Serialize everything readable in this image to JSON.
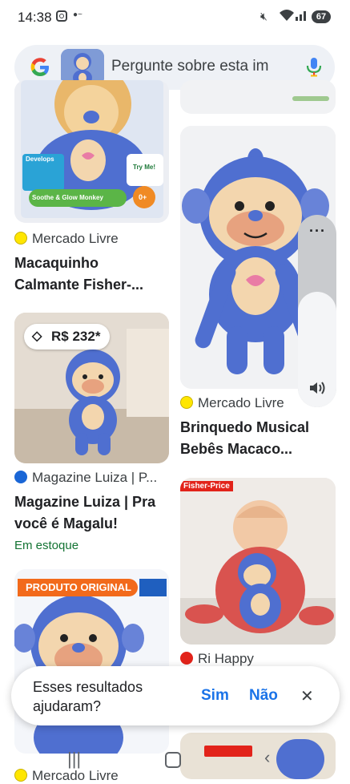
{
  "status_bar": {
    "time": "14:38",
    "battery": "67",
    "icons": [
      "instagram-icon",
      "mute-icon",
      "wifi-icon",
      "signal-icon"
    ]
  },
  "search": {
    "placeholder": "Pergunte sobre esta im",
    "icons": [
      "google-logo",
      "mic-icon"
    ]
  },
  "results": [
    {
      "source": "Mercado Livre",
      "title_line1": "Macaquinho",
      "title_line2": "Calmante Fisher-...",
      "box_tag": "Develops",
      "box_try": "Try Me!",
      "box_name": "Soothe & Glow Monkey",
      "box_age": "0+"
    },
    {
      "source": "Mercado Livre",
      "title_line1": "Brinquedo Musical",
      "title_line2": "Bebês Macaco..."
    },
    {
      "source": "Magazine Luiza | P...",
      "title_line1": "Magazine Luiza | Pra",
      "title_line2": "você é Magalu!",
      "stock": "Em estoque",
      "price": "R$ 232*"
    },
    {
      "source": "Ri Happy",
      "brand_tag": "Fisher-Price"
    },
    {
      "banner": "PRODUTO ORIGINAL",
      "source": "Mercado Livre"
    }
  ],
  "feedback": {
    "question_line1": "Esses resultados",
    "question_line2": "ajudaram?",
    "yes": "Sim",
    "no": "Não"
  },
  "colors": {
    "accent": "#1a73e8",
    "stock_green": "#137333",
    "monkey_blue": "#4f6fd0",
    "search_bg": "#eef1f6"
  }
}
